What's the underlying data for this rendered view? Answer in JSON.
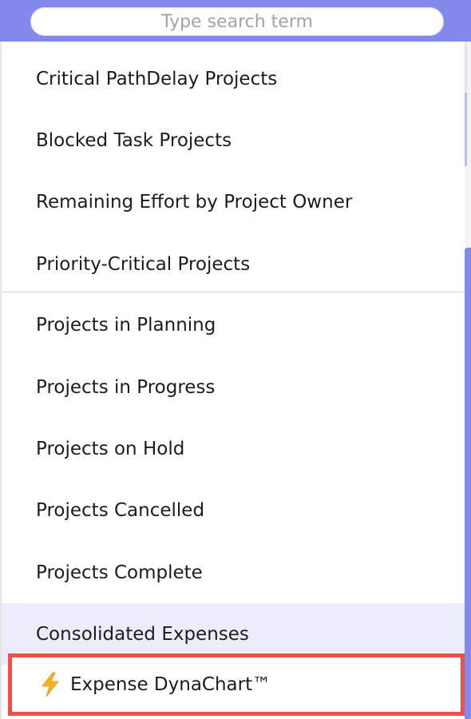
{
  "search": {
    "placeholder": "Type search term",
    "value": ""
  },
  "menu": {
    "items": [
      {
        "label": "Critical PathDelay Projects"
      },
      {
        "label": "Blocked Task Projects"
      },
      {
        "label": "Remaining Effort by Project Owner"
      },
      {
        "label": "Priority-Critical Projects"
      },
      {
        "label": "Projects in Planning"
      },
      {
        "label": "Projects in Progress"
      },
      {
        "label": "Projects on Hold"
      },
      {
        "label": "Projects Cancelled"
      },
      {
        "label": "Projects Complete"
      },
      {
        "label": "Consolidated Expenses"
      }
    ],
    "highlighted": {
      "label": "Expense DynaChart™",
      "icon": "lightning-bolt-icon"
    }
  },
  "colors": {
    "header": "#8389ec",
    "hover": "#ecedfb",
    "highlight_border": "#ef4f47",
    "bolt": "#f5b324"
  }
}
